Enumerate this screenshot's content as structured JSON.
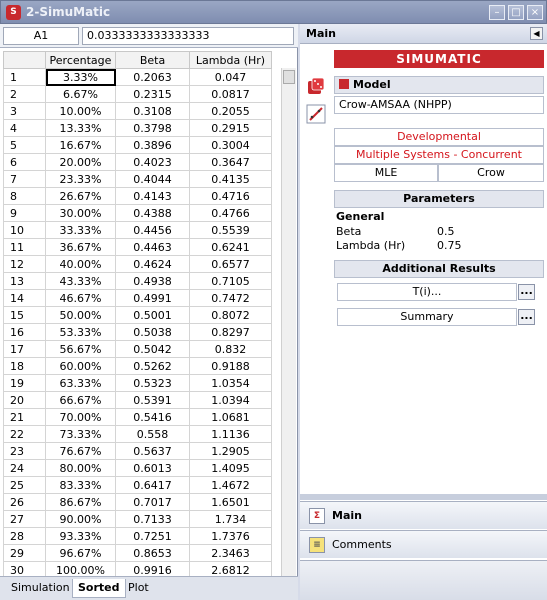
{
  "window": {
    "title": "2-SimuMatic"
  },
  "formula_bar": {
    "cell_ref": "A1",
    "cell_value": "0.0333333333333333"
  },
  "grid": {
    "columns": [
      "Percentage",
      "Beta",
      "Lambda (Hr)"
    ],
    "rows": [
      [
        "1",
        "3.33%",
        "0.2063",
        "0.047"
      ],
      [
        "2",
        "6.67%",
        "0.2315",
        "0.0817"
      ],
      [
        "3",
        "10.00%",
        "0.3108",
        "0.2055"
      ],
      [
        "4",
        "13.33%",
        "0.3798",
        "0.2915"
      ],
      [
        "5",
        "16.67%",
        "0.3896",
        "0.3004"
      ],
      [
        "6",
        "20.00%",
        "0.4023",
        "0.3647"
      ],
      [
        "7",
        "23.33%",
        "0.4044",
        "0.4135"
      ],
      [
        "8",
        "26.67%",
        "0.4143",
        "0.4716"
      ],
      [
        "9",
        "30.00%",
        "0.4388",
        "0.4766"
      ],
      [
        "10",
        "33.33%",
        "0.4456",
        "0.5539"
      ],
      [
        "11",
        "36.67%",
        "0.4463",
        "0.6241"
      ],
      [
        "12",
        "40.00%",
        "0.4624",
        "0.6577"
      ],
      [
        "13",
        "43.33%",
        "0.4938",
        "0.7105"
      ],
      [
        "14",
        "46.67%",
        "0.4991",
        "0.7472"
      ],
      [
        "15",
        "50.00%",
        "0.5001",
        "0.8072"
      ],
      [
        "16",
        "53.33%",
        "0.5038",
        "0.8297"
      ],
      [
        "17",
        "56.67%",
        "0.5042",
        "0.832"
      ],
      [
        "18",
        "60.00%",
        "0.5262",
        "0.9188"
      ],
      [
        "19",
        "63.33%",
        "0.5323",
        "1.0354"
      ],
      [
        "20",
        "66.67%",
        "0.5391",
        "1.0394"
      ],
      [
        "21",
        "70.00%",
        "0.5416",
        "1.0681"
      ],
      [
        "22",
        "73.33%",
        "0.558",
        "1.1136"
      ],
      [
        "23",
        "76.67%",
        "0.5637",
        "1.2905"
      ],
      [
        "24",
        "80.00%",
        "0.6013",
        "1.4095"
      ],
      [
        "25",
        "83.33%",
        "0.6417",
        "1.4672"
      ],
      [
        "26",
        "86.67%",
        "0.7017",
        "1.6501"
      ],
      [
        "27",
        "90.00%",
        "0.7133",
        "1.734"
      ],
      [
        "28",
        "93.33%",
        "0.7251",
        "1.7376"
      ],
      [
        "29",
        "96.67%",
        "0.8653",
        "2.3463"
      ],
      [
        "30",
        "100.00%",
        "0.9916",
        "2.6812"
      ]
    ]
  },
  "sheet_tabs": [
    "Simulation",
    "Sorted",
    "Plot"
  ],
  "active_tab": "Sorted",
  "panel": {
    "header": "Main",
    "brand": "SIMUMATIC",
    "model_label": "Model",
    "model_value": "Crow-AMSAA (NHPP)",
    "developmental": "Developmental",
    "systems": "Multiple Systems - Concurrent",
    "method": "MLE",
    "method2": "Crow",
    "parameters_label": "Parameters",
    "general_label": "General",
    "beta_label": "Beta",
    "beta_value": "0.5",
    "lambda_label": "Lambda (Hr)",
    "lambda_value": "0.75",
    "additional_label": "Additional Results",
    "ti_button": "T(i)...",
    "summary_button": "Summary",
    "dots": "...",
    "nav_main": "Main",
    "nav_comments": "Comments"
  },
  "colors": {
    "brand_red": "#c8282d",
    "text_red": "#d4141b",
    "titlebar": "#8a97b7"
  }
}
